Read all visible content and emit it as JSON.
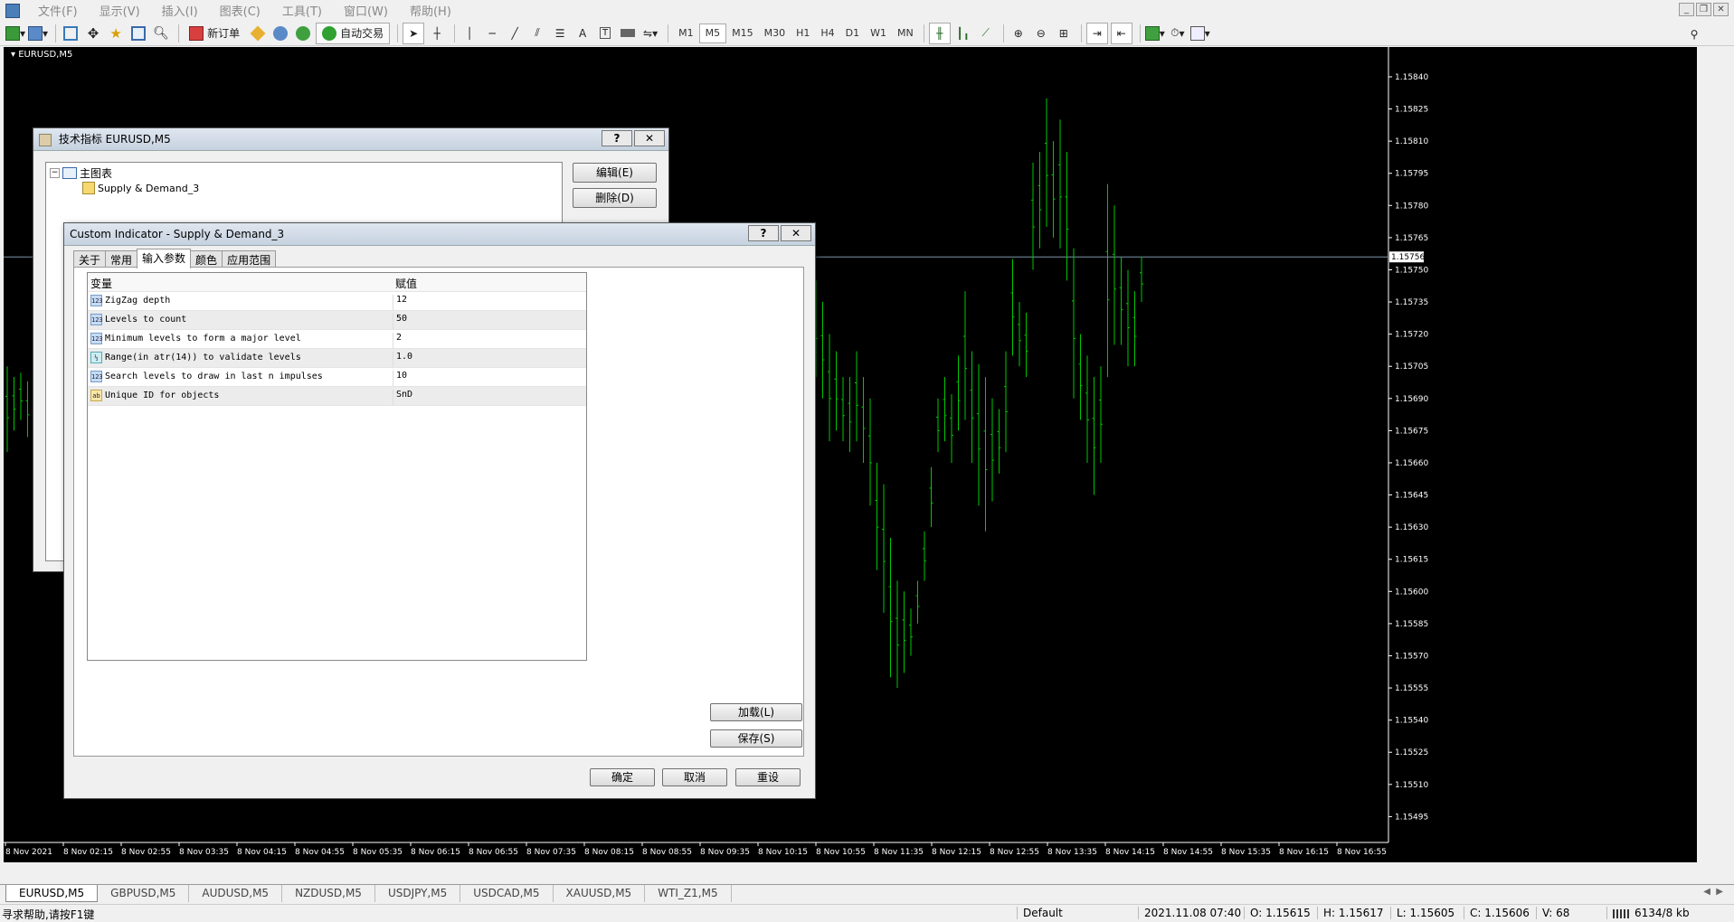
{
  "menu": [
    "文件(F)",
    "显示(V)",
    "插入(I)",
    "图表(C)",
    "工具(T)",
    "窗口(W)",
    "帮助(H)"
  ],
  "toolbar": {
    "new_order": "新订单",
    "auto_trading": "自动交易",
    "timeframes": [
      "M1",
      "M5",
      "M15",
      "M30",
      "H1",
      "H4",
      "D1",
      "W1",
      "MN"
    ],
    "active_timeframe": "M5"
  },
  "chart": {
    "title": "EURUSD,M5",
    "current_price": "1.15756",
    "price_labels": [
      "1.15840",
      "1.15825",
      "1.15810",
      "1.15795",
      "1.15780",
      "1.15765",
      "1.15750",
      "1.15735",
      "1.15720",
      "1.15705",
      "1.15690",
      "1.15675",
      "1.15660",
      "1.15645",
      "1.15630",
      "1.15615",
      "1.15600",
      "1.15585",
      "1.15570",
      "1.15555",
      "1.15540",
      "1.15525",
      "1.15510",
      "1.15495"
    ],
    "time_labels": [
      "8 Nov 2021",
      "8 Nov 02:15",
      "8 Nov 02:55",
      "8 Nov 03:35",
      "8 Nov 04:15",
      "8 Nov 04:55",
      "8 Nov 05:35",
      "8 Nov 06:15",
      "8 Nov 06:55",
      "8 Nov 07:35",
      "8 Nov 08:15",
      "8 Nov 08:55",
      "8 Nov 09:35",
      "8 Nov 10:15",
      "8 Nov 10:55",
      "8 Nov 11:35",
      "8 Nov 12:15",
      "8 Nov 12:55",
      "8 Nov 13:35",
      "8 Nov 14:15",
      "8 Nov 14:55",
      "8 Nov 15:35",
      "8 Nov 16:15",
      "8 Nov 16:55"
    ],
    "bar_color": "#00c800"
  },
  "chart_data": {
    "type": "line",
    "title": "EURUSD,M5",
    "ylim": [
      1.15488,
      1.15848
    ],
    "series": [
      {
        "segment": "left-edge",
        "high": [
          1.15705,
          1.157,
          1.15702,
          1.15698
        ],
        "low": [
          1.15665,
          1.15675,
          1.1568,
          1.15672
        ]
      },
      {
        "segment": "right",
        "high": [
          1.15745,
          1.15735,
          1.1572,
          1.15712,
          1.157,
          1.157,
          1.15712,
          1.157,
          1.1569,
          1.1566,
          1.1565,
          1.15625,
          1.15605,
          1.156,
          1.15592,
          1.15605,
          1.15628,
          1.15658,
          1.1569,
          1.157,
          1.15692,
          1.1571,
          1.1574,
          1.15712,
          1.15706,
          1.157,
          1.1569,
          1.15685,
          1.15712,
          1.15755,
          1.15735,
          1.1573,
          1.158,
          1.15805,
          1.1583,
          1.1581,
          1.1582,
          1.15805,
          1.1576,
          1.1572,
          1.1571,
          1.157,
          1.15705,
          1.1579,
          1.1578,
          1.15756,
          1.1575,
          1.1574,
          1.15756
        ],
        "low": [
          1.157,
          1.1569,
          1.1567,
          1.15675,
          1.1567,
          1.15665,
          1.1567,
          1.1566,
          1.1564,
          1.1561,
          1.1559,
          1.1556,
          1.15555,
          1.15562,
          1.1557,
          1.15585,
          1.15605,
          1.1563,
          1.15665,
          1.1567,
          1.1566,
          1.15675,
          1.1568,
          1.1566,
          1.1564,
          1.15628,
          1.15642,
          1.15655,
          1.15665,
          1.1571,
          1.15705,
          1.157,
          1.1575,
          1.1576,
          1.1577,
          1.15765,
          1.1576,
          1.15745,
          1.1569,
          1.1568,
          1.1566,
          1.15645,
          1.1566,
          1.157,
          1.15715,
          1.15715,
          1.15705,
          1.15705,
          1.15735
        ]
      }
    ]
  },
  "tech_dialog": {
    "title": "技术指标 EURUSD,M5",
    "help": "?",
    "close": "✕",
    "tree_root": "主图表",
    "tree_child": "Supply & Demand_3",
    "edit_button": "编辑(E)",
    "delete_button": "删除(D)"
  },
  "custom_dialog": {
    "title": "Custom Indicator - Supply & Demand_3",
    "help": "?",
    "close": "✕",
    "tabs": [
      "关于",
      "常用",
      "输入参数",
      "颜色",
      "应用范围"
    ],
    "active_tab": "输入参数",
    "col_variable": "变量",
    "col_value": "赋值",
    "params": [
      {
        "type": "123",
        "name": "ZigZag depth",
        "value": "12"
      },
      {
        "type": "123",
        "name": "Levels to count",
        "value": "50"
      },
      {
        "type": "123",
        "name": "Minimum levels to form a major level",
        "value": "2"
      },
      {
        "type": "½",
        "name": "Range(in atr(14)) to validate levels",
        "value": "1.0"
      },
      {
        "type": "123",
        "name": "Search levels to draw in last n impulses",
        "value": "10"
      },
      {
        "type": "ab",
        "name": "Unique ID for objects",
        "value": "SnD"
      }
    ],
    "load_button": "加载(L)",
    "save_button": "保存(S)",
    "ok_button": "确定",
    "cancel_button": "取消",
    "reset_button": "重设"
  },
  "symbol_tabs": [
    "EURUSD,M5",
    "GBPUSD,M5",
    "AUDUSD,M5",
    "NZDUSD,M5",
    "USDJPY,M5",
    "USDCAD,M5",
    "XAUUSD,M5",
    "WTI_Z1,M5"
  ],
  "status": {
    "help": "寻求帮助,请按F1键",
    "profile": "Default",
    "datetime": "2021.11.08 07:40",
    "open": "O: 1.15615",
    "high": "H: 1.15617",
    "low": "L: 1.15605",
    "close": "C: 1.15606",
    "volume": "V: 68",
    "traffic": "6134/8 kb"
  }
}
